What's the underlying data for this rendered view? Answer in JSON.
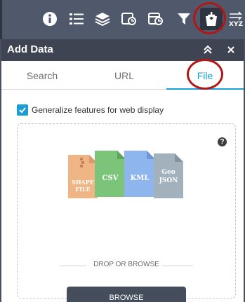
{
  "toolbar": {
    "tools": [
      {
        "icon": "info-icon"
      },
      {
        "icon": "legend-list-icon"
      },
      {
        "icon": "layers-icon"
      },
      {
        "icon": "query-icon"
      },
      {
        "icon": "query-table-icon"
      },
      {
        "icon": "filter-icon"
      },
      {
        "icon": "add-data-icon",
        "active": true
      },
      {
        "icon": "xyz-coordinate-icon",
        "text": "XYZ"
      }
    ]
  },
  "panel": {
    "title": "Add Data",
    "tabs": [
      {
        "label": "Search"
      },
      {
        "label": "URL"
      },
      {
        "label": "File",
        "selected": true
      }
    ],
    "generalize": {
      "label": "Generalize features for web display",
      "checked": true
    },
    "file_types": [
      "SHAPE FILE",
      "CSV",
      "KML",
      "Geo JSON"
    ],
    "file_type_lines": {
      "shape": [
        "SHAPE",
        "FILE"
      ],
      "csv": [
        "CSV"
      ],
      "kml": [
        "KML"
      ],
      "geojson": [
        "Geo",
        "JSON"
      ]
    },
    "drop_label": "DROP OR BROWSE",
    "browse_label": "BROWSE",
    "help_glyph": "?"
  },
  "colors": {
    "toolbar": "#50596b",
    "panel_header": "#3e4451",
    "accent": "#1aa0d8",
    "annotation": "#b01818",
    "shape_file": "#f0b585",
    "csv": "#7cc47a",
    "kml": "#8fb5ee",
    "geojson": "#a2b1bc"
  }
}
